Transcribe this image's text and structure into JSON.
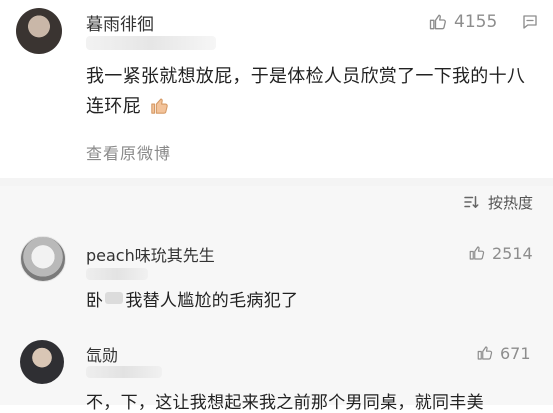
{
  "post": {
    "author": "暮雨徘徊",
    "likes": "4155",
    "text": "我一紧张就想放屁，于是体检人员欣赏了一下我的十八连环屁",
    "view_original": "查看原微博"
  },
  "comments_header": {
    "sort_label": "按热度"
  },
  "comments": [
    {
      "author": "peach味玧其先生",
      "likes": "2514",
      "text_a": "卧",
      "text_b": "我替人尴尬的毛病犯了"
    },
    {
      "author": "氙勋",
      "likes": "671",
      "text": "不，下，这让我想起来我之前那个男同桌，就同丰美"
    }
  ],
  "icons": {
    "like": "thumbs-up-icon",
    "comment": "comment-icon",
    "sort": "sort-icon",
    "emoji": "thumbs-up-emoji"
  }
}
